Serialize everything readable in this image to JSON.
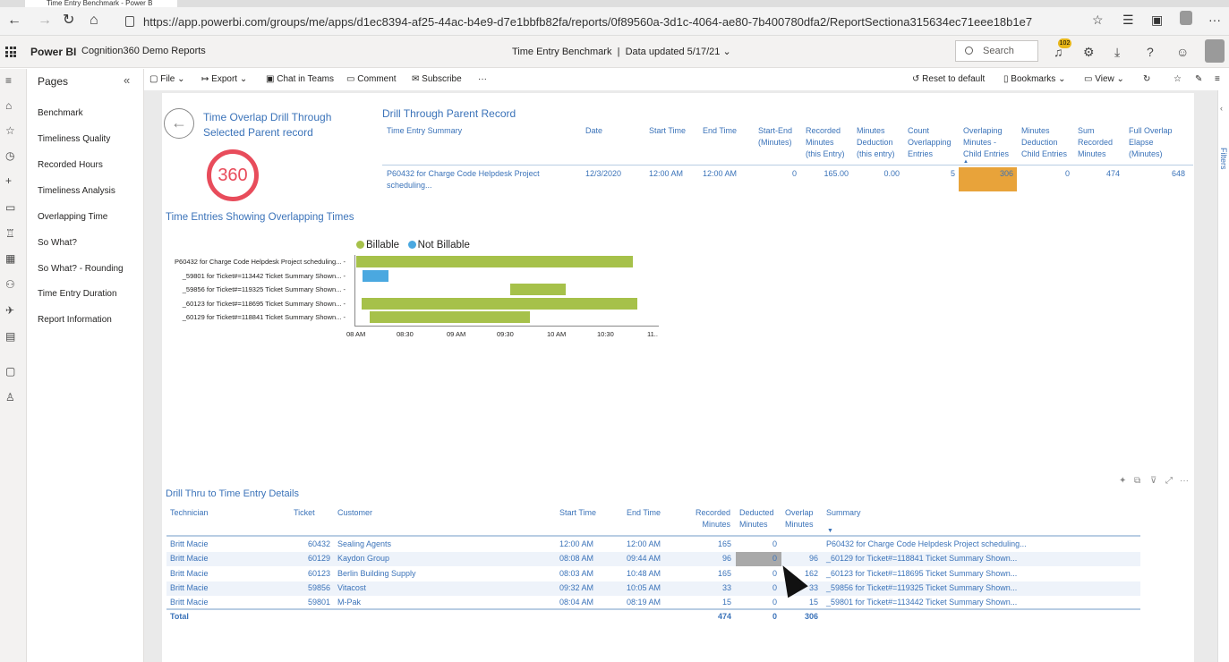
{
  "browser": {
    "tab_title": "Time Entry Benchmark - Power B",
    "url": "https://app.powerbi.com/groups/me/apps/d1ec8394-af25-44ac-b4e9-d7e1bbfb82fa/reports/0f89560a-3d1c-4064-ae80-7b400780dfa2/ReportSectiona315634ec71eee18b1e7"
  },
  "header": {
    "brand": "Power BI",
    "workspace": "Cognition360 Demo Reports",
    "report_title": "Time Entry Benchmark",
    "data_updated": "Data updated 5/17/21",
    "search_placeholder": "Search",
    "notification_count": "102"
  },
  "pages": {
    "title": "Pages",
    "items": [
      "Benchmark",
      "Timeliness Quality",
      "Recorded Hours",
      "Timeliness Analysis",
      "Overlapping Time",
      "So What?",
      "So What? - Rounding",
      "Time Entry Duration",
      "Report Information"
    ]
  },
  "toolbar": {
    "file": "File",
    "export": "Export",
    "chat": "Chat in Teams",
    "comment": "Comment",
    "subscribe": "Subscribe",
    "more": "···",
    "reset": "Reset to default",
    "bookmarks": "Bookmarks",
    "view": "View"
  },
  "rightpane": {
    "filters": "Filters"
  },
  "drill": {
    "title_line1": "Time Overlap Drill Through",
    "title_line2": "Selected Parent record",
    "logo_text": "360"
  },
  "parent": {
    "title": "Drill Through Parent Record",
    "headers": [
      "Time Entry Summary",
      "Date",
      "Start Time",
      "End Time",
      "Start-End (Minutes)",
      "Recorded Minutes (this Entry)",
      "Minutes Deduction (this entry)",
      "Count Overlapping Entries",
      "Overlaping Minutes - Child Entries",
      "Minutes Deduction Child Entries",
      "Sum Recorded Minutes",
      "Full Overlap Elapse (Minutes)"
    ],
    "row": {
      "summary_line1": "P60432 for Charge Code Helpdesk Project",
      "summary_line2": "scheduling...",
      "date": "12/3/2020",
      "start": "12:00 AM",
      "end": "12:00 AM",
      "start_end": "0",
      "recorded": "165.00",
      "deduction": "0.00",
      "count": "5",
      "overlap_child": "306",
      "deduction_child": "0",
      "sum_recorded": "474",
      "full_overlap": "648"
    }
  },
  "gantt": {
    "title": "Time Entries Showing Overlapping Times",
    "legend": [
      {
        "name": "Billable",
        "color": "#a6c14a"
      },
      {
        "name": "Not Billable",
        "color": "#4aa8e0"
      }
    ],
    "rows": [
      {
        "label": "P60432 for Charge Code Helpdesk Project scheduling...",
        "start": "08:00",
        "end": "10:45",
        "billable": true
      },
      {
        "label": "_59801 for Ticket#=113442 Ticket Summary Shown...",
        "start": "08:04",
        "end": "08:19",
        "billable": false
      },
      {
        "label": "_59856 for Ticket#=119325 Ticket Summary Shown...",
        "start": "09:32",
        "end": "10:05",
        "billable": true
      },
      {
        "label": "_60123 for Ticket#=118695 Ticket Summary Shown...",
        "start": "08:03",
        "end": "10:48",
        "billable": true
      },
      {
        "label": "_60129 for Ticket#=118841 Ticket Summary Shown...",
        "start": "08:08",
        "end": "09:44",
        "billable": true
      }
    ],
    "ticks": [
      "08 AM",
      "08:30",
      "09 AM",
      "09:30",
      "10 AM",
      "10:30",
      "11.."
    ]
  },
  "details": {
    "title": "Drill Thru to Time Entry Details",
    "headers": {
      "technician": "Technician",
      "ticket": "Ticket",
      "customer": "Customer",
      "start": "Start Time",
      "end": "End Time",
      "recorded": [
        "Recorded",
        "Minutes"
      ],
      "deducted": [
        "Deducted",
        "Minutes"
      ],
      "overlap": [
        "Overlap",
        "Minutes"
      ],
      "summary": "Summary"
    },
    "rows": [
      {
        "tech": "Britt Macie",
        "ticket": "60432",
        "customer": "Sealing Agents",
        "start": "12:00 AM",
        "end": "12:00 AM",
        "recorded": "165",
        "deducted": "0",
        "overlap": "",
        "summary": "P60432 for Charge Code Helpdesk Project scheduling..."
      },
      {
        "tech": "Britt Macie",
        "ticket": "60129",
        "customer": "Kaydon Group",
        "start": "08:08 AM",
        "end": "09:44 AM",
        "recorded": "96",
        "deducted": "0",
        "overlap": "96",
        "summary": "_60129 for Ticket#=118841 Ticket Summary Shown..."
      },
      {
        "tech": "Britt Macie",
        "ticket": "60123",
        "customer": "Berlin Building Supply",
        "start": "08:03 AM",
        "end": "10:48 AM",
        "recorded": "165",
        "deducted": "0",
        "overlap": "162",
        "summary": "_60123 for Ticket#=118695 Ticket Summary Shown..."
      },
      {
        "tech": "Britt Macie",
        "ticket": "59856",
        "customer": "Vitacost",
        "start": "09:32 AM",
        "end": "10:05 AM",
        "recorded": "33",
        "deducted": "0",
        "overlap": "33",
        "summary": "_59856 for Ticket#=119325 Ticket Summary Shown..."
      },
      {
        "tech": "Britt Macie",
        "ticket": "59801",
        "customer": "M-Pak",
        "start": "08:04 AM",
        "end": "08:19 AM",
        "recorded": "15",
        "deducted": "0",
        "overlap": "15",
        "summary": "_59801 for Ticket#=113442 Ticket Summary Shown..."
      }
    ],
    "total": {
      "label": "Total",
      "recorded": "474",
      "deducted": "0",
      "overlap": "306"
    }
  }
}
